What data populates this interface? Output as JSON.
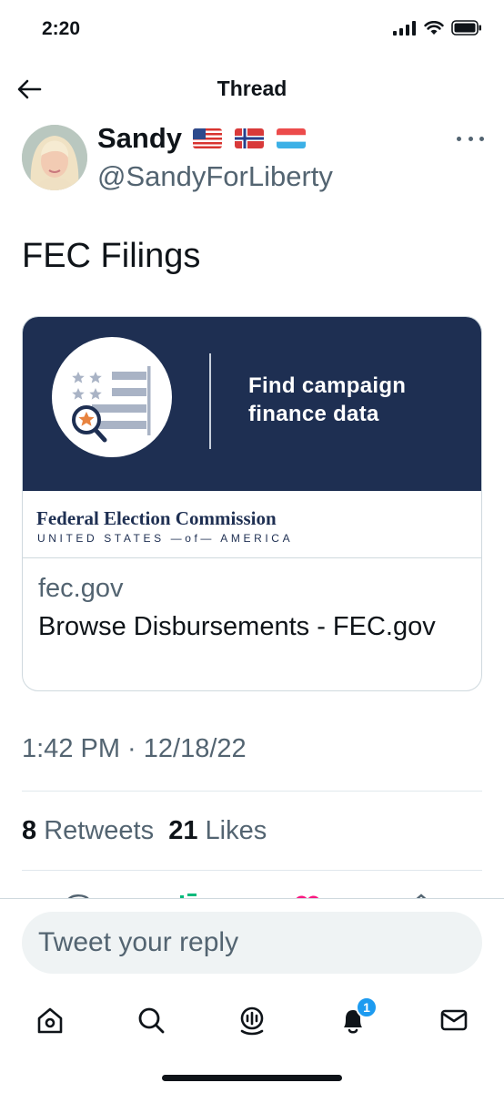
{
  "status_bar": {
    "time": "2:20"
  },
  "header": {
    "title": "Thread"
  },
  "tweet": {
    "author_name": "Sandy",
    "author_handle": "@SandyForLiberty",
    "text": "FEC Filings",
    "timestamp": "1:42 PM · 12/18/22",
    "retweets_count": "8",
    "retweets_label": "Retweets",
    "likes_count": "21",
    "likes_label": "Likes"
  },
  "card": {
    "banner_text": "Find campaign finance data",
    "org_name": "Federal Election Commission",
    "org_subtitle": "UNITED STATES —of— AMERICA",
    "domain": "fec.gov",
    "title": "Browse Disbursements - FEC.gov"
  },
  "reply": {
    "placeholder": "Tweet your reply"
  },
  "tabbar": {
    "notifications_badge": "1"
  },
  "icons": [
    "back-arrow-icon",
    "signal-icon",
    "wifi-icon",
    "battery-icon",
    "more-icon",
    "home-icon",
    "search-icon",
    "spaces-icon",
    "notifications-icon",
    "messages-icon"
  ],
  "colors": {
    "accent": "#1d9bf0",
    "card_banner": "#1e2f52",
    "secondary_text": "#536471"
  }
}
